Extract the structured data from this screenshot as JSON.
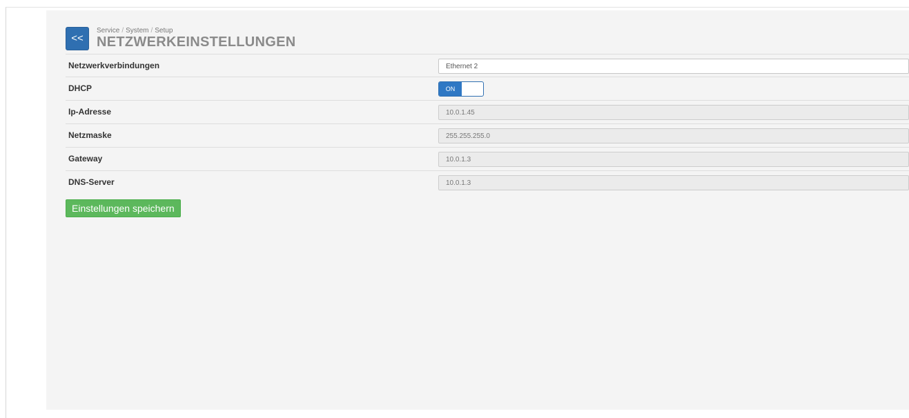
{
  "header": {
    "back_label": "<<",
    "breadcrumb": [
      "Service",
      "System",
      "Setup"
    ],
    "breadcrumb_separator": "/",
    "title": "NETZWERKEINSTELLUNGEN"
  },
  "form": {
    "rows": [
      {
        "label": "Netzwerkverbindungen",
        "value": "Ethernet 2",
        "editable": true
      },
      {
        "label": "DHCP",
        "toggle_label": "ON",
        "toggle_state": "on"
      },
      {
        "label": "Ip-Adresse",
        "value": "10.0.1.45",
        "editable": false
      },
      {
        "label": "Netzmaske",
        "value": "255.255.255.0",
        "editable": false
      },
      {
        "label": "Gateway",
        "value": "10.0.1.3",
        "editable": false
      },
      {
        "label": "DNS-Server",
        "value": "10.0.1.3",
        "editable": false
      }
    ],
    "save_label": "Einstellungen speichern"
  },
  "colors": {
    "primary": "#2f6fb1",
    "success": "#5cb85c",
    "panel_background": "#f4f4f4",
    "title_gray": "#8a8a8a"
  }
}
